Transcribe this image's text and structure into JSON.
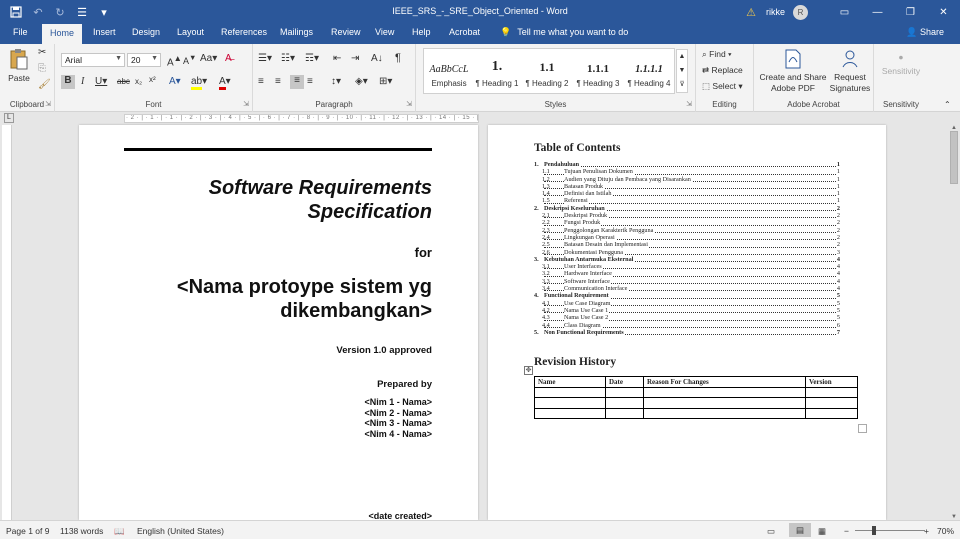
{
  "titlebar": {
    "document_title": "IEEE_SRS_-_SRE_Object_Oriented - Word",
    "user_name": "rikke",
    "user_initial": "R"
  },
  "tabs": [
    "File",
    "Home",
    "Insert",
    "Design",
    "Layout",
    "References",
    "Mailings",
    "Review",
    "View",
    "Help",
    "Acrobat"
  ],
  "active_tab": "Home",
  "tell_me": "Tell me what you want to do",
  "share": "Share",
  "ribbon": {
    "clipboard": {
      "label": "Clipboard",
      "paste": "Paste"
    },
    "font": {
      "label": "Font",
      "font_name": "Arial",
      "font_size": "20"
    },
    "paragraph": {
      "label": "Paragraph"
    },
    "styles": {
      "label": "Styles",
      "items": [
        {
          "preview": "AaBbCcL",
          "name": "Emphasis"
        },
        {
          "preview": "1.",
          "name": "¶ Heading 1"
        },
        {
          "preview": "1.1",
          "name": "¶ Heading 2"
        },
        {
          "preview": "1.1.1",
          "name": "¶ Heading 3"
        },
        {
          "preview": "1.1.1.1",
          "name": "¶ Heading 4"
        }
      ]
    },
    "editing": {
      "label": "Editing",
      "find": "Find",
      "replace": "Replace",
      "select": "Select"
    },
    "acrobat": {
      "label": "Adobe Acrobat",
      "create_share": "Create and Share Adobe PDF",
      "request_signatures": "Request Signatures"
    },
    "sensitivity": {
      "label": "Sensitivity",
      "button": "Sensitivity"
    }
  },
  "ruler_text": "· 2 · | · 1 · | · 1 · | · 2 · | · 3 · | · 4 · | · 5 · | · 6 · | · 7 · | · 8 · | · 9 · | · 10 · | · 11 · | · 12 · | · 13 · | · 14 · | · 15 · | · 16 · | · 17 · | · 18 · | 19",
  "page1": {
    "title_line1": "Software Requirements",
    "title_line2": "Specification",
    "for": "for",
    "name_line1": "<Nama protoype sistem yg",
    "name_line2": "dikembangkan>",
    "version": "Version 1.0 approved",
    "prepared_by": "Prepared by",
    "nims": [
      "<Nim 1 - Nama>",
      "<Nim 2 - Nama>",
      "<Nim 3 - Nama>",
      "<Nim 4 - Nama>"
    ],
    "date_created": "<date created>"
  },
  "page2": {
    "toc_title": "Table of Contents",
    "toc": [
      {
        "num": "1.",
        "text": "Pendahuluan",
        "page": "1",
        "level": 1
      },
      {
        "num": "1.1",
        "text": "Tujuan Penulisan Dokumen",
        "page": "1",
        "level": 2
      },
      {
        "num": "1.2",
        "text": "Audien yang Dituju dan Pembaca yang Disarankan",
        "page": "1",
        "level": 2
      },
      {
        "num": "1.3",
        "text": "Batasan Produk",
        "page": "1",
        "level": 2
      },
      {
        "num": "1.4",
        "text": "Definisi dan Istilah",
        "page": "1",
        "level": 2
      },
      {
        "num": "1.5",
        "text": "Referensi",
        "page": "1",
        "level": 2
      },
      {
        "num": "2.",
        "text": "Deskripsi Keseluruhan",
        "page": "2",
        "level": 1
      },
      {
        "num": "2.1",
        "text": "Deskripsi Produk",
        "page": "2",
        "level": 2
      },
      {
        "num": "2.2",
        "text": "Fungsi Produk",
        "page": "2",
        "level": 2
      },
      {
        "num": "2.3",
        "text": "Penggolongan Karakterik Pengguna",
        "page": "2",
        "level": 2
      },
      {
        "num": "2.4",
        "text": "Lingkungan Operasi",
        "page": "2",
        "level": 2
      },
      {
        "num": "2.5",
        "text": "Batasan Desain dan Implementasi",
        "page": "2",
        "level": 2
      },
      {
        "num": "2.6",
        "text": "Dokumentasi Pengguna",
        "page": "3",
        "level": 2
      },
      {
        "num": "3.",
        "text": "Kebutuhan Antarmuka Eksternal",
        "page": "4",
        "level": 1
      },
      {
        "num": "3.1",
        "text": "User Interfaces",
        "page": "4",
        "level": 2
      },
      {
        "num": "3.2",
        "text": "Hardware Interface",
        "page": "4",
        "level": 2
      },
      {
        "num": "3.3",
        "text": "Software Interface",
        "page": "4",
        "level": 2
      },
      {
        "num": "3.4",
        "text": "Communication Interface",
        "page": "4",
        "level": 2
      },
      {
        "num": "4.",
        "text": "Functional Requirement",
        "page": "5",
        "level": 1
      },
      {
        "num": "4.1",
        "text": "Use Case Diagram",
        "page": "5",
        "level": 2
      },
      {
        "num": "4.2",
        "text": "Nama Use Case 1",
        "page": "5",
        "level": 2
      },
      {
        "num": "4.3",
        "text": "Nama Use Case 2",
        "page": "5",
        "level": 2
      },
      {
        "num": "4.4",
        "text": "Class Diagram",
        "page": "6",
        "level": 2
      },
      {
        "num": "5.",
        "text": "Non Functional Requirements",
        "page": "7",
        "level": 1
      }
    ],
    "revision_title": "Revision History",
    "revision_headers": [
      "Name",
      "Date",
      "Reason For Changes",
      "Version"
    ],
    "revision_rows": [
      [
        "",
        "",
        "",
        ""
      ],
      [
        "",
        "",
        "",
        ""
      ],
      [
        "",
        "",
        "",
        ""
      ]
    ]
  },
  "status": {
    "page": "Page 1 of 9",
    "words": "1138 words",
    "language": "English (United States)",
    "zoom": "70%"
  }
}
